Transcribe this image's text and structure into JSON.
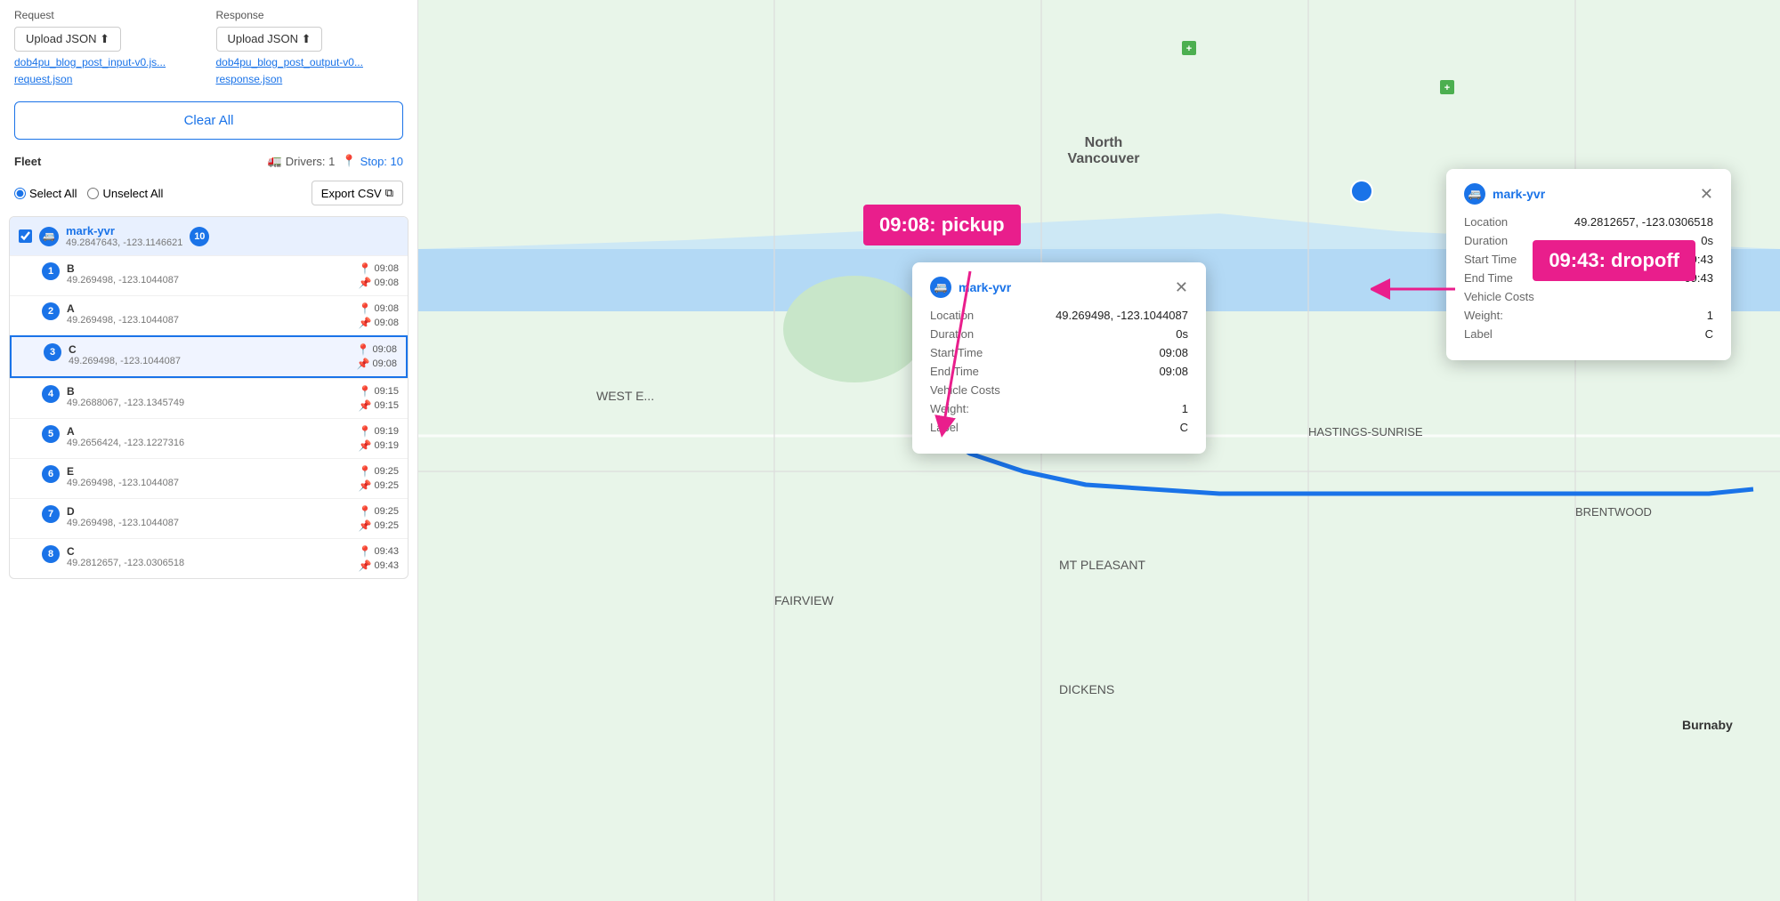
{
  "leftPanel": {
    "request": {
      "label": "Request",
      "uploadBtn": "Upload JSON ⬆",
      "fileName": "dob4pu_blog_post_input-v0.js...",
      "fileLink": "request.json"
    },
    "response": {
      "label": "Response",
      "uploadBtn": "Upload JSON ⬆",
      "fileName": "dob4pu_blog_post_output-v0...",
      "fileLink": "response.json"
    },
    "clearAll": "Clear All",
    "fleet": {
      "label": "Fleet",
      "drivers": "Drivers: 1",
      "stops": "Stop: 10",
      "selectAll": "Select All",
      "unselectAll": "Unselect All",
      "exportCsv": "Export CSV"
    },
    "driver": {
      "name": "mark-yvr",
      "coords": "49.2847643, -123.1146621",
      "stopCount": 10,
      "checked": true,
      "stops": [
        {
          "num": 1,
          "label": "B",
          "coords": "49.269498, -123.1044087",
          "time1": "09:08",
          "time2": "09:08"
        },
        {
          "num": 2,
          "label": "A",
          "coords": "49.269498, -123.1044087",
          "time1": "09:08",
          "time2": "09:08"
        },
        {
          "num": 3,
          "label": "C",
          "coords": "49.269498, -123.1044087",
          "time1": "09:08",
          "time2": "09:08",
          "active": true
        },
        {
          "num": 4,
          "label": "B",
          "coords": "49.2688067, -123.1345749",
          "time1": "09:15",
          "time2": "09:15"
        },
        {
          "num": 5,
          "label": "A",
          "coords": "49.2656424, -123.1227316",
          "time1": "09:19",
          "time2": "09:19"
        },
        {
          "num": 6,
          "label": "E",
          "coords": "49.269498, -123.1044087",
          "time1": "09:25",
          "time2": "09:25"
        },
        {
          "num": 7,
          "label": "D",
          "coords": "49.269498, -123.1044087",
          "time1": "09:25",
          "time2": "09:25"
        },
        {
          "num": 8,
          "label": "C",
          "coords": "49.2812657, -123.0306518",
          "time1": "09:43",
          "time2": "09:43"
        }
      ]
    }
  },
  "popups": {
    "pickup": {
      "title": "mark-yvr",
      "location": "49.269498, -123.1044087",
      "duration": "0s",
      "startTime": "09:08",
      "endTime": "09:08",
      "vehicleCosts": "",
      "weight": "1",
      "label": "C"
    },
    "dropoff": {
      "title": "mark-yvr",
      "location": "49.2812657, -123.0306518",
      "duration": "0s",
      "startTime": "09:43",
      "endTime": "09:43",
      "vehicleCosts": "",
      "weight": "1",
      "label": "C"
    }
  },
  "annotations": {
    "pickup": "09:08: pickup",
    "dropoff": "09:43: dropoff"
  },
  "fields": {
    "location": "Location",
    "duration": "Duration",
    "startTime": "Start Time",
    "endTime": "End Time",
    "vehicleCosts": "Vehicle Costs",
    "weight": "Weight:",
    "label": "Label"
  }
}
